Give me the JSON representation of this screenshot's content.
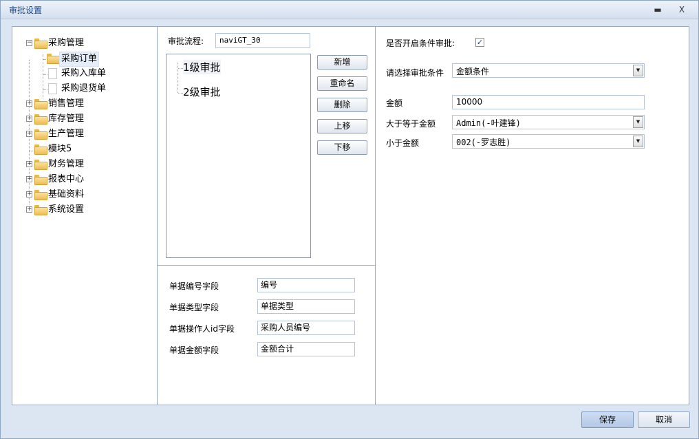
{
  "window": {
    "title": "审批设置",
    "minimize_label": "▬",
    "close_label": "X"
  },
  "tree": {
    "items": [
      {
        "label": "采购管理"
      },
      {
        "label": "采购订单"
      },
      {
        "label": "采购入库单"
      },
      {
        "label": "采购退货单"
      },
      {
        "label": "销售管理"
      },
      {
        "label": "库存管理"
      },
      {
        "label": "生产管理"
      },
      {
        "label": "模块5"
      },
      {
        "label": "财务管理"
      },
      {
        "label": "报表中心"
      },
      {
        "label": "基础资料"
      },
      {
        "label": "系统设置"
      }
    ],
    "expand_minus": "−",
    "expand_plus": "+"
  },
  "flow": {
    "label": "审批流程:",
    "value": "naviGT_30",
    "items": [
      "1级审批",
      "2级审批"
    ],
    "buttons": {
      "add": "新增",
      "rename": "重命名",
      "delete": "删除",
      "up": "上移",
      "down": "下移"
    }
  },
  "fields": [
    {
      "label": "单据编号字段",
      "value": "编号"
    },
    {
      "label": "单据类型字段",
      "value": "单据类型"
    },
    {
      "label": "单据操作人id字段",
      "value": "采购人员编号"
    },
    {
      "label": "单据金额字段",
      "value": "金额合计"
    }
  ],
  "condition": {
    "enable_label": "是否开启条件审批:",
    "enable_checked": true,
    "check_mark": "✓",
    "select_label": "请选择审批条件",
    "select_value": "金额条件",
    "amount_label": "金额",
    "amount_value": "10000",
    "gte_label": "大于等于金额",
    "gte_value": "Admin(-叶建锋)",
    "lt_label": "小于金额",
    "lt_value": "002(-罗志胜)",
    "arrow": "▼"
  },
  "footer": {
    "save": "保存",
    "cancel": "取消"
  }
}
